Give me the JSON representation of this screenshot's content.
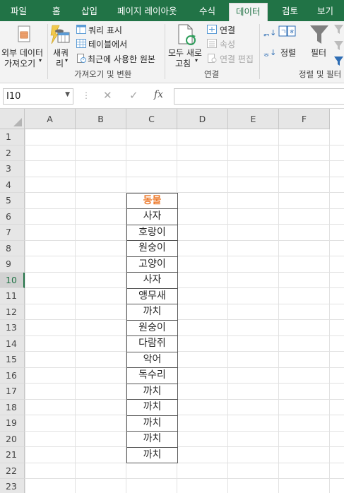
{
  "tabs": [
    {
      "label": "파일",
      "active": false
    },
    {
      "label": "홈",
      "active": false
    },
    {
      "label": "삽입",
      "active": false
    },
    {
      "label": "페이지 레이아웃",
      "active": false
    },
    {
      "label": "수식",
      "active": false
    },
    {
      "label": "데이터",
      "active": true
    },
    {
      "label": "검토",
      "active": false
    },
    {
      "label": "보기",
      "active": false
    }
  ],
  "ribbon": {
    "get_data": {
      "external_line1": "외부 데이터",
      "external_line2": "가져오기",
      "new_query_line1": "새쿼",
      "new_query_line2": "리",
      "show_query": "쿼리 표시",
      "from_table": "테이블에서",
      "recent_sources": "최근에 사용한 원본",
      "group_label": "가져오기 및 변환"
    },
    "connections": {
      "refresh_line1": "모두 새로",
      "refresh_line2": "고침",
      "connections": "연결",
      "properties": "속성",
      "edit_links": "연결 편집",
      "group_label": "연결"
    },
    "sort_filter": {
      "sort": "정렬",
      "filter": "필터",
      "group_label": "정렬 및 필터"
    }
  },
  "formula_bar": {
    "name_box": "I10",
    "dots": "⋮",
    "cancel": "✕",
    "enter": "✓",
    "fx": "fx",
    "value": ""
  },
  "grid": {
    "columns": [
      "A",
      "B",
      "C",
      "D",
      "E",
      "F"
    ],
    "rows": [
      "1",
      "2",
      "3",
      "4",
      "5",
      "6",
      "7",
      "8",
      "9",
      "10",
      "11",
      "12",
      "13",
      "14",
      "15",
      "16",
      "17",
      "18",
      "19",
      "20",
      "21",
      "22",
      "23"
    ],
    "selected_row": "10",
    "table_header": "동물",
    "table_values": [
      "사자",
      "호랑이",
      "원숭이",
      "고양이",
      "사자",
      "앵무새",
      "까치",
      "원숭이",
      "다람쥐",
      "악어",
      "독수리",
      "까치",
      "까치",
      "까치",
      "까치",
      "까치"
    ]
  },
  "colors": {
    "excel_green": "#217346",
    "header_orange": "#ed7d31"
  }
}
